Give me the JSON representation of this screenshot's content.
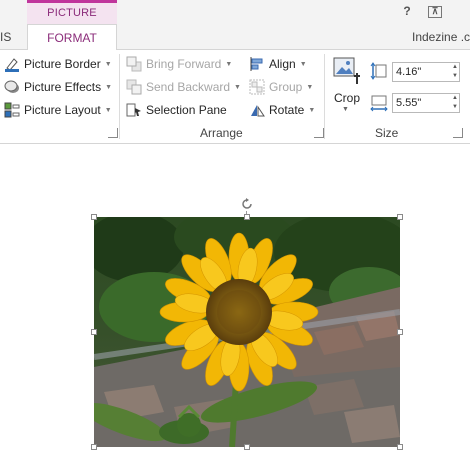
{
  "contextual_tab": {
    "label": "PICTURE TOOLS"
  },
  "tabs": {
    "partial_left": "IS",
    "format": "FORMAT",
    "user": "Indezine .c"
  },
  "window": {
    "help": "?",
    "restore": "⊼"
  },
  "picture_styles": {
    "border": "Picture Border",
    "effects": "Picture Effects",
    "layout": "Picture Layout"
  },
  "arrange": {
    "bring_forward": "Bring Forward",
    "send_backward": "Send Backward",
    "selection_pane": "Selection Pane",
    "align": "Align",
    "group": "Group",
    "rotate": "Rotate",
    "label": "Arrange"
  },
  "size": {
    "crop": "Crop",
    "height": "4.16\"",
    "width": "5.55\"",
    "label": "Size"
  },
  "colors": {
    "accent": "#8b2c7a",
    "contextual_bg": "#f4e3f0",
    "contextual_border": "#c0359c"
  },
  "icons": [
    "picture-border-icon",
    "picture-effects-icon",
    "picture-layout-icon",
    "bring-forward-icon",
    "send-backward-icon",
    "selection-pane-icon",
    "align-icon",
    "group-icon",
    "rotate-icon",
    "crop-icon",
    "height-icon",
    "width-icon",
    "rotation-handle-icon"
  ]
}
